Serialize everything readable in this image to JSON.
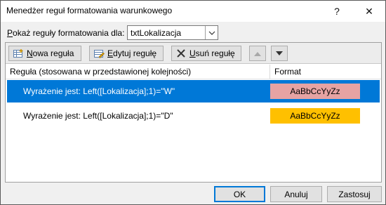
{
  "window": {
    "title": "Menedżer reguł formatowania warunkowego",
    "help_label": "?",
    "close_label": "✕"
  },
  "show_rules": {
    "label_prefix": "P",
    "label_rest": "okaż reguły formatowania dla:",
    "selected_value": "txtLokalizacja"
  },
  "toolbar": {
    "new_rule_accel": "N",
    "new_rule_rest": "owa reguła",
    "edit_rule_accel": "E",
    "edit_rule_rest": "dytuj regułę",
    "delete_rule_accel": "U",
    "delete_rule_rest": "suń regułę"
  },
  "table": {
    "headers": {
      "rule": "Reguła (stosowana w przedstawionej kolejności)",
      "format": "Format"
    },
    "rows": [
      {
        "rule": "Wyrażenie jest: Left([Lokalizacja];1)=\"W\"",
        "format_preview": "AaBbCcYyZz",
        "format_color": "#e6a3a3",
        "selected": true
      },
      {
        "rule": "Wyrażenie jest: Left([Lokalizacja];1)=\"D\"",
        "format_preview": "AaBbCcYyZz",
        "format_color": "#ffc000",
        "selected": false
      }
    ]
  },
  "buttons": {
    "ok": "OK",
    "cancel": "Anuluj",
    "apply": "Zastosuj"
  },
  "colors": {
    "selection": "#0078d7"
  }
}
